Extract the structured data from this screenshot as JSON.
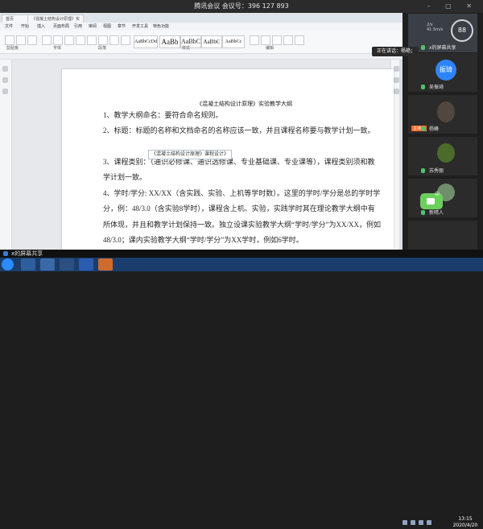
{
  "meeting": {
    "title": "腾讯会议 会议号：396 127 893"
  },
  "screen_share": {
    "tabs": [
      "首页",
      "《混凝土结构设计原理》实验教学大纲.docx"
    ],
    "menu_items": [
      "文件",
      "开始",
      "插入",
      "页面布局",
      "引用",
      "审阅",
      "视图",
      "章节",
      "开发工具",
      "特色功能"
    ],
    "style_box_1": "AaBbCcDd",
    "style_box_2": "AaBb",
    "style_box_3": "AaBbC",
    "style_box_4": "AaBbC",
    "style_box_5": "AaBbCc",
    "toolbar_labels": [
      "剪贴板",
      "字体",
      "段落",
      "样式",
      "编辑"
    ]
  },
  "document": {
    "heading": "《混凝土结构设计原理》实验教学大纲",
    "textbox": "《混凝土结构设计原理》课程设计》",
    "paragraphs": [
      "1、教学大纲命名：要符合命名规则。",
      "2、标题：标题的名称和文档命名的名称应该一致，并且课程名称要与教学计划一致。",
      "3、课程类别：（通识必修课、通识选修课、专业基础课、专业课等），课程类别须和教学计划一致。",
      "4、学时/学分: XX/XX（含实践、实验、上机等学时数）。这里的学时/学分是总的学时学分，例：48/3.0（含实验8学时），课程含上机、实验，实践学时其在理论教学大纲中有所体现，并且和教学计划保持一致。独立设课实验教学大纲“学时/学分”为XX/XX，例如48/3.0；课内实验教学大纲“学时/学分”为XX学时，例如6学时。"
    ]
  },
  "participants": {
    "speaking_popup": "正在讲话：杨艳；",
    "tiles": [
      {
        "name": "x的屏幕共享"
      },
      {
        "name": "吴振琦",
        "avatar_text": "振琦"
      },
      {
        "name": "杨峰"
      },
      {
        "name": "苏秀丽"
      },
      {
        "name": "新晴人"
      },
      {
        "name": ""
      }
    ],
    "host_tag": "主持人",
    "stats": {
      "line1": "2/s",
      "line2": "41.5m/s"
    },
    "gauge_value": "88",
    "green_widget_label": "中"
  },
  "share_bar": {
    "label": "x的屏幕共享"
  },
  "taskbar": {
    "time": "13:15",
    "date": "2020/4/20"
  },
  "colors": {
    "meeting_bar": "#2b2b2b",
    "panel_bg": "#1f1f1f",
    "host_tag": "#ff6a2a",
    "avatar_blue": "#2e84ff",
    "windows_taskbar": "#1b3d6b"
  }
}
